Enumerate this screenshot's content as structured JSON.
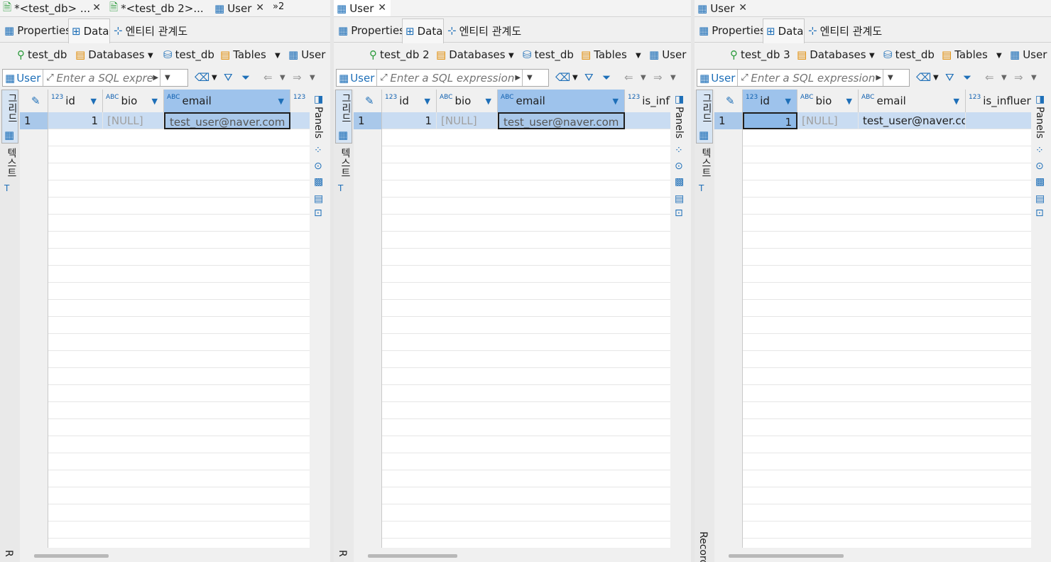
{
  "panes": [
    {
      "tabs": [
        {
          "label": "*<test_db> ...",
          "closable": true
        },
        {
          "label": "*<test_db 2>...",
          "closable": false
        },
        {
          "label": "User",
          "closable": true
        }
      ],
      "overflow": "»2",
      "subtabs": [
        "Properties",
        "Data",
        "엔티티 관계도"
      ],
      "crumbs": {
        "connection": "test_db",
        "databases": "Databases",
        "db": "test_db",
        "tables": "Tables",
        "table": "User"
      },
      "filter": {
        "table": "User",
        "placeholder": "Enter a SQL express"
      },
      "columns": [
        {
          "type": "123",
          "name": "id"
        },
        {
          "type": "ABC",
          "name": "bio"
        },
        {
          "type": "ABC",
          "name": "email"
        },
        {
          "type": "123",
          "name": ""
        }
      ],
      "row": {
        "num": "1",
        "id": "1",
        "bio": "[NULL]",
        "email": "test_user@naver.com"
      },
      "left_tabs": [
        "그리드",
        "텍스트"
      ],
      "left_bottom": "R",
      "right_label": "Panels"
    },
    {
      "tabs": [
        {
          "label": "User",
          "closable": true
        }
      ],
      "overflow": "",
      "subtabs": [
        "Properties",
        "Data",
        "엔티티 관계도"
      ],
      "crumbs": {
        "connection": "test_db 2",
        "databases": "Databases",
        "db": "test_db",
        "tables": "Tables",
        "table": "User"
      },
      "filter": {
        "table": "User",
        "placeholder": "Enter a SQL expression to"
      },
      "columns": [
        {
          "type": "123",
          "name": "id"
        },
        {
          "type": "ABC",
          "name": "bio"
        },
        {
          "type": "ABC",
          "name": "email"
        },
        {
          "type": "123",
          "name": "is_influ"
        }
      ],
      "row": {
        "num": "1",
        "id": "1",
        "bio": "[NULL]",
        "email": "test_user@naver.com"
      },
      "left_tabs": [
        "그리드",
        "텍스트"
      ],
      "left_bottom": "R",
      "right_label": "Panels"
    },
    {
      "tabs": [
        {
          "label": "User",
          "closable": true
        }
      ],
      "overflow": "",
      "subtabs": [
        "Properties",
        "Data",
        "엔티티 관계도"
      ],
      "crumbs": {
        "connection": "test_db 3",
        "databases": "Databases",
        "db": "test_db",
        "tables": "Tables",
        "table": "User"
      },
      "filter": {
        "table": "User",
        "placeholder": "Enter a SQL expression to"
      },
      "columns": [
        {
          "type": "123",
          "name": "id"
        },
        {
          "type": "ABC",
          "name": "bio"
        },
        {
          "type": "ABC",
          "name": "email"
        },
        {
          "type": "123",
          "name": "is_influenc"
        }
      ],
      "row": {
        "num": "1",
        "id": "1",
        "bio": "[NULL]",
        "email": "test_user@naver.com"
      },
      "left_tabs": [
        "그리드",
        "텍스트"
      ],
      "left_bottom": "Record",
      "right_label": "Panels"
    }
  ],
  "icons": {
    "table": "table-icon",
    "data": "data-icon",
    "erd": "erd-icon",
    "connection": "connection-icon",
    "folder": "folder-icon",
    "database": "database-icon",
    "eraser": "eraser-icon",
    "filter": "filter-icon",
    "back": "back-icon",
    "forward": "forward-icon",
    "close": "close-icon",
    "edit": "pencil-icon"
  },
  "colors": {
    "selection": "#c9dcf2",
    "header_selected": "#9ec3ec",
    "accent": "#1e6fb8",
    "null_text": "#a0a0a0"
  }
}
